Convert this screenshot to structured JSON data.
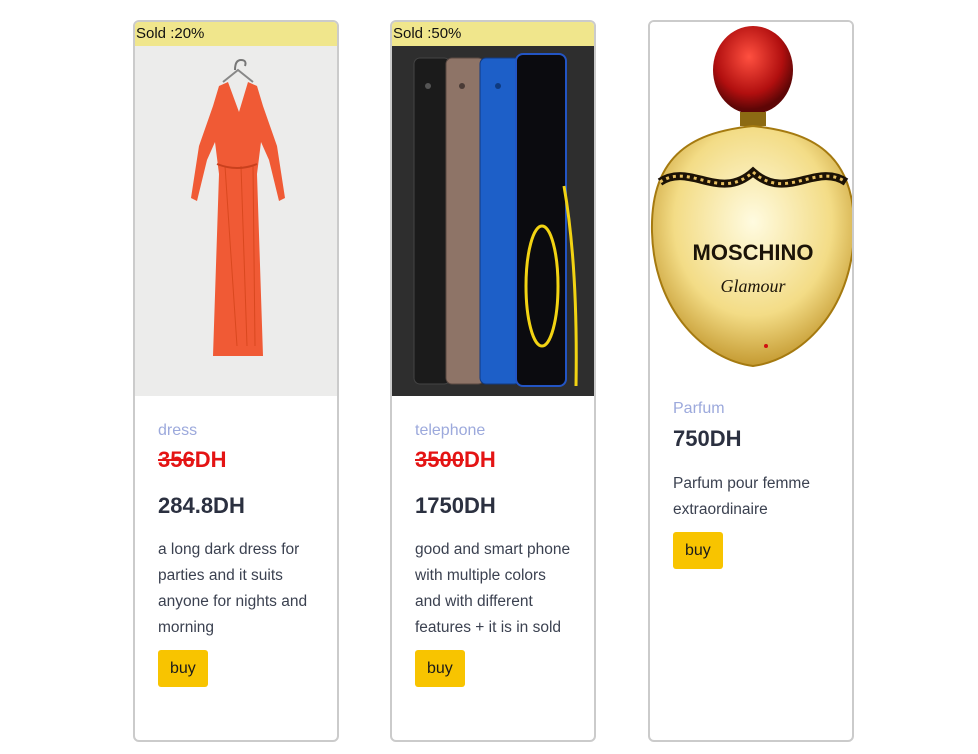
{
  "products": [
    {
      "sale_badge": "Sold :20%",
      "category": "dress",
      "old_price": "356",
      "old_currency": "DH",
      "price": "284.8DH",
      "description": "a long dark dress for parties and it suits anyone for nights and morning",
      "buy_label": "buy"
    },
    {
      "sale_badge": "Sold :50%",
      "category": "telephone",
      "old_price": "3500",
      "old_currency": "DH",
      "price": "1750DH",
      "description": "good and smart phone with multiple colors and with different features + it is in sold",
      "buy_label": "buy"
    },
    {
      "category": "Parfum",
      "price": "750DH",
      "description": "Parfum pour femme extraordinaire",
      "buy_label": "buy",
      "image_text": {
        "brand": "MOSCHINO",
        "line": "Glamour"
      }
    }
  ],
  "colors": {
    "sale_badge_bg": "#f0e68c",
    "buy_button": "#f8c400",
    "old_price": "#e41414",
    "category": "#9ca9dc"
  }
}
